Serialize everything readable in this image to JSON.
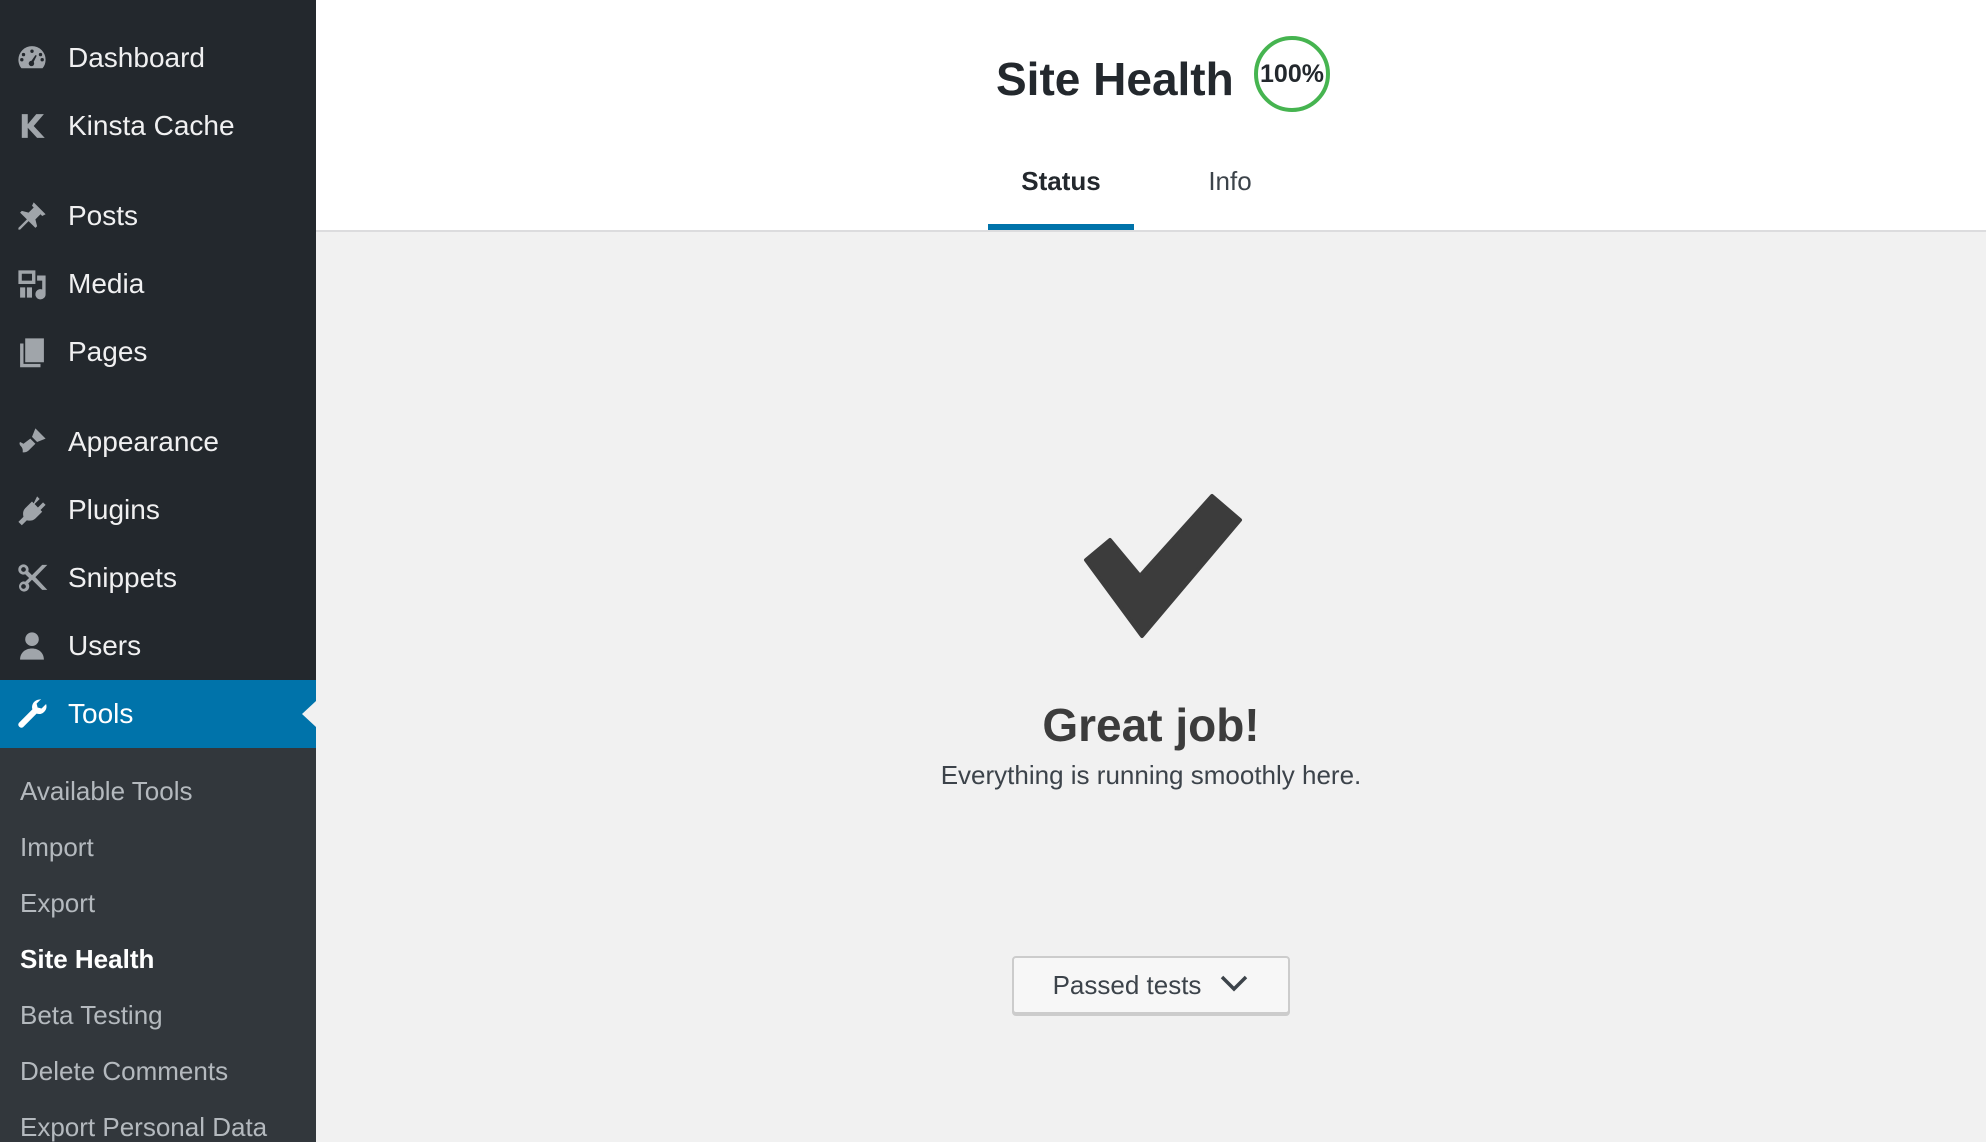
{
  "sidebar": {
    "items": [
      {
        "label": "Dashboard",
        "icon": "dashboard-icon"
      },
      {
        "label": "Kinsta Cache",
        "icon": "kinsta-icon"
      },
      {
        "label": "Posts",
        "icon": "pin-icon"
      },
      {
        "label": "Media",
        "icon": "media-icon"
      },
      {
        "label": "Pages",
        "icon": "pages-icon"
      },
      {
        "label": "Appearance",
        "icon": "brush-icon"
      },
      {
        "label": "Plugins",
        "icon": "plugin-icon"
      },
      {
        "label": "Snippets",
        "icon": "scissors-icon"
      },
      {
        "label": "Users",
        "icon": "user-icon"
      },
      {
        "label": "Tools",
        "icon": "wrench-icon",
        "active": true
      }
    ],
    "submenu": [
      {
        "label": "Available Tools"
      },
      {
        "label": "Import"
      },
      {
        "label": "Export"
      },
      {
        "label": "Site Health",
        "current": true
      },
      {
        "label": "Beta Testing"
      },
      {
        "label": "Delete Comments"
      },
      {
        "label": "Export Personal Data"
      }
    ]
  },
  "header": {
    "title": "Site Health",
    "score": "100%",
    "tabs": [
      {
        "label": "Status",
        "active": true
      },
      {
        "label": "Info"
      }
    ]
  },
  "main": {
    "heading": "Great job!",
    "message": "Everything is running smoothly here.",
    "passed_button_label": "Passed tests"
  },
  "colors": {
    "sidebar_bg": "#23282d",
    "submenu_bg": "#32373c",
    "active_blue": "#0073aa",
    "score_green": "#46b450",
    "content_bg": "#f1f1f1"
  }
}
